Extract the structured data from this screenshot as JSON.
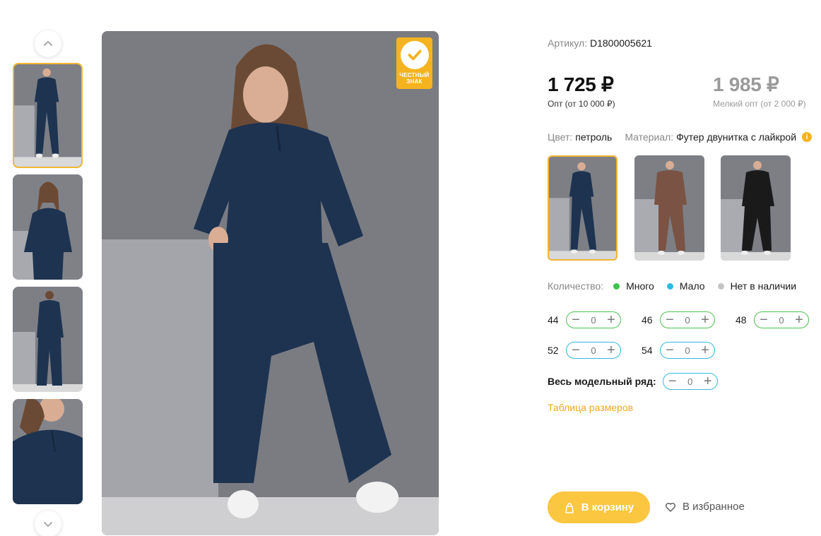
{
  "badge": {
    "text_line1": "ЧЕСТНЫЙ",
    "text_line2": "ЗНАК"
  },
  "product": {
    "sku_label": "Артикул:",
    "sku_value": "D1800005621",
    "price_main": "1 725 ₽",
    "price_main_note": "Опт (от 10 000 ₽)",
    "price_alt": "1 985 ₽",
    "price_alt_note": "Мелкий опт (от 2 000 ₽)",
    "color_label": "Цвет:",
    "color_value": "петроль",
    "material_label": "Материал:",
    "material_value": "Футер двунитка с лайкрой",
    "info_icon": "i"
  },
  "color_variants": [
    {
      "name": "petrol",
      "color": "#1d3350"
    },
    {
      "name": "brown",
      "color": "#7a5344"
    },
    {
      "name": "black",
      "color": "#1a1a1a"
    }
  ],
  "quantity": {
    "label": "Количество:",
    "legend": [
      {
        "label": "Много",
        "color": "#3ec34c"
      },
      {
        "label": "Мало",
        "color": "#2bbbe6"
      },
      {
        "label": "Нет в наличии",
        "color": "#c4c4c4"
      }
    ],
    "sizes": [
      {
        "size": "44",
        "qty": "0",
        "stock": "many"
      },
      {
        "size": "46",
        "qty": "0",
        "stock": "many"
      },
      {
        "size": "48",
        "qty": "0",
        "stock": "many"
      },
      {
        "size": "52",
        "qty": "0",
        "stock": "few"
      },
      {
        "size": "54",
        "qty": "0",
        "stock": "few"
      }
    ],
    "full_range_label": "Весь модельный ряд:",
    "full_range_qty": "0"
  },
  "size_table_link": "Таблица размеров",
  "actions": {
    "cart_label": "В корзину",
    "favorite_label": "В избранное"
  },
  "colors": {
    "accent": "#fcc740",
    "link": "#f0a91e",
    "many": "#4cc24f",
    "few": "#35b8e0"
  }
}
